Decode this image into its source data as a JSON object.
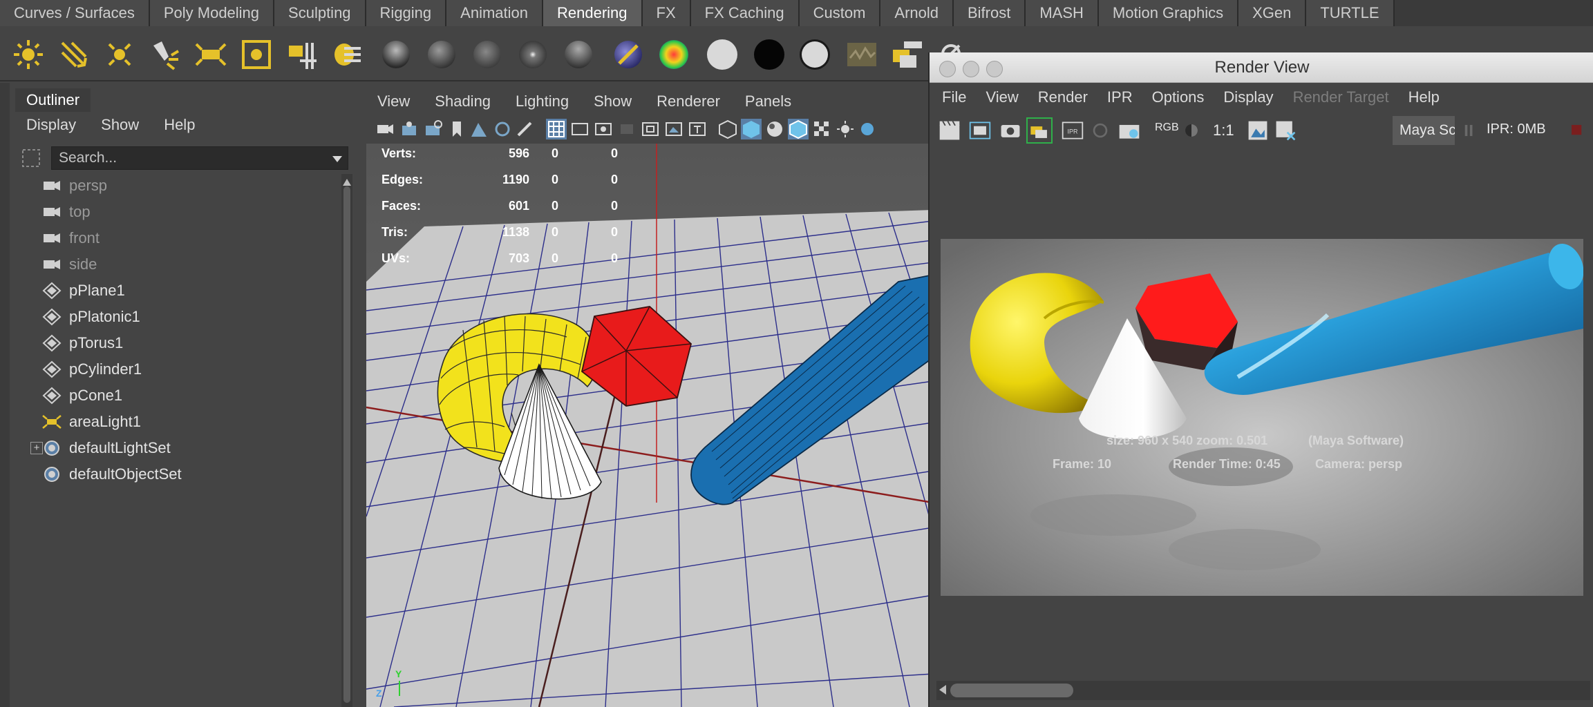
{
  "shelf": {
    "tabs": [
      "Curves / Surfaces",
      "Poly Modeling",
      "Sculpting",
      "Rigging",
      "Animation",
      "Rendering",
      "FX",
      "FX Caching",
      "Custom",
      "Arnold",
      "Bifrost",
      "MASH",
      "Motion Graphics",
      "XGen",
      "TURTLE"
    ],
    "active_tab": "Rendering",
    "icons": [
      "ambient-light-icon",
      "directional-light-icon",
      "point-light-icon",
      "spot-light-icon",
      "area-light-icon",
      "volume-light-icon",
      "light-editor-icon",
      "hypershade-icon",
      "shader-ball-icon",
      "shader-ball-icon",
      "shader-ball-icon",
      "shader-ball-icon",
      "shader-ball-icon",
      "shader-ball-icon",
      "ramp-shader-icon",
      "white-swatch-icon",
      "black-swatch-icon",
      "white-swatch-icon",
      "render-icon",
      "batch-render-icon",
      "render-settings-icon"
    ]
  },
  "outliner": {
    "tab": "Outliner",
    "menu": [
      "Display",
      "Show",
      "Help"
    ],
    "search_placeholder": "Search...",
    "items": [
      {
        "label": "persp",
        "icon": "camera-icon",
        "dim": true
      },
      {
        "label": "top",
        "icon": "camera-icon",
        "dim": true
      },
      {
        "label": "front",
        "icon": "camera-icon",
        "dim": true
      },
      {
        "label": "side",
        "icon": "camera-icon",
        "dim": true
      },
      {
        "label": "pPlane1",
        "icon": "mesh-icon",
        "dim": false
      },
      {
        "label": "pPlatonic1",
        "icon": "mesh-icon",
        "dim": false
      },
      {
        "label": "pTorus1",
        "icon": "mesh-icon",
        "dim": false
      },
      {
        "label": "pCylinder1",
        "icon": "mesh-icon",
        "dim": false
      },
      {
        "label": "pCone1",
        "icon": "mesh-icon",
        "dim": false
      },
      {
        "label": "areaLight1",
        "icon": "area-light-icon",
        "dim": false
      },
      {
        "label": "defaultLightSet",
        "icon": "set-icon",
        "dim": false,
        "expandable": true
      },
      {
        "label": "defaultObjectSet",
        "icon": "set-icon",
        "dim": false
      }
    ]
  },
  "viewport": {
    "menu": [
      "View",
      "Shading",
      "Lighting",
      "Show",
      "Renderer",
      "Panels"
    ],
    "hud": {
      "rows": [
        {
          "label": "Verts:",
          "values": [
            "596",
            "0",
            "0"
          ]
        },
        {
          "label": "Edges:",
          "values": [
            "1190",
            "0",
            "0"
          ]
        },
        {
          "label": "Faces:",
          "values": [
            "601",
            "0",
            "0"
          ]
        },
        {
          "label": "Tris:",
          "values": [
            "1138",
            "0",
            "0"
          ]
        },
        {
          "label": "UVs:",
          "values": [
            "703",
            "0",
            "0"
          ]
        }
      ]
    },
    "axis": {
      "y": "Y",
      "z": "Z"
    }
  },
  "render_view": {
    "title": "Render View",
    "menu": [
      "File",
      "View",
      "Render",
      "IPR",
      "Options",
      "Display",
      "Render Target",
      "Help"
    ],
    "disabled_menu": "Render Target",
    "toolbar": {
      "rgb": "RGB",
      "ratio": "1:1",
      "renderer": "Maya Sc",
      "ipr_memory": "IPR: 0MB"
    },
    "info": {
      "size_zoom": "size: 960 x 540 zoom: 0.501",
      "renderer": "(Maya Software)",
      "frame": "Frame: 10",
      "render_time": "Render Time: 0:45",
      "camera": "Camera: persp"
    }
  },
  "colors": {
    "accent_active_tab": "#5d5d5d",
    "icon_yellow": "#e5c12a",
    "torus_yellow": "#f2e21c",
    "platonic_red": "#e81b1b",
    "cylinder_blue": "#1a6fb0",
    "grid_line": "#2c2e8a",
    "axis_red": "#8c1d1d"
  }
}
